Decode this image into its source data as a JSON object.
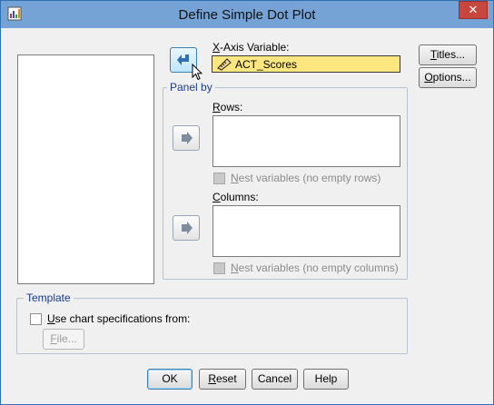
{
  "window": {
    "title": "Define Simple Dot Plot",
    "close_glyph": "✕"
  },
  "xaxis": {
    "label_pre": "",
    "label_key": "X",
    "label_post": "-Axis Variable:",
    "value": "ACT_Scores"
  },
  "panel": {
    "legend": "Panel by",
    "rows": {
      "label_key": "R",
      "label_post": "ows:"
    },
    "rows_nest": {
      "label_key": "N",
      "label_post": "est variables (no empty rows)"
    },
    "columns": {
      "label_key": "C",
      "label_post": "olumns:"
    },
    "columns_nest": {
      "label_key": "N",
      "label_post": "est variables (no empty columns)"
    }
  },
  "template": {
    "legend": "Template",
    "use_key": "U",
    "use_post": "se chart specifications from:",
    "file_key": "F",
    "file_post": "ile..."
  },
  "side_buttons": {
    "titles_key": "T",
    "titles_post": "itles...",
    "options_key": "O",
    "options_post": "ptions..."
  },
  "bottom_buttons": {
    "ok": "OK",
    "reset_key": "R",
    "reset_post": "eset",
    "cancel": "Cancel",
    "help": "Help"
  },
  "colors": {
    "titlebar": "#76a3d6",
    "accent_arrow": "#2f6fb3",
    "highlight_field": "#fbe680"
  },
  "icons": [
    "app-chart-icon",
    "close-icon",
    "arrow-icon",
    "ruler-scale-icon",
    "mouse-pointer-icon"
  ]
}
